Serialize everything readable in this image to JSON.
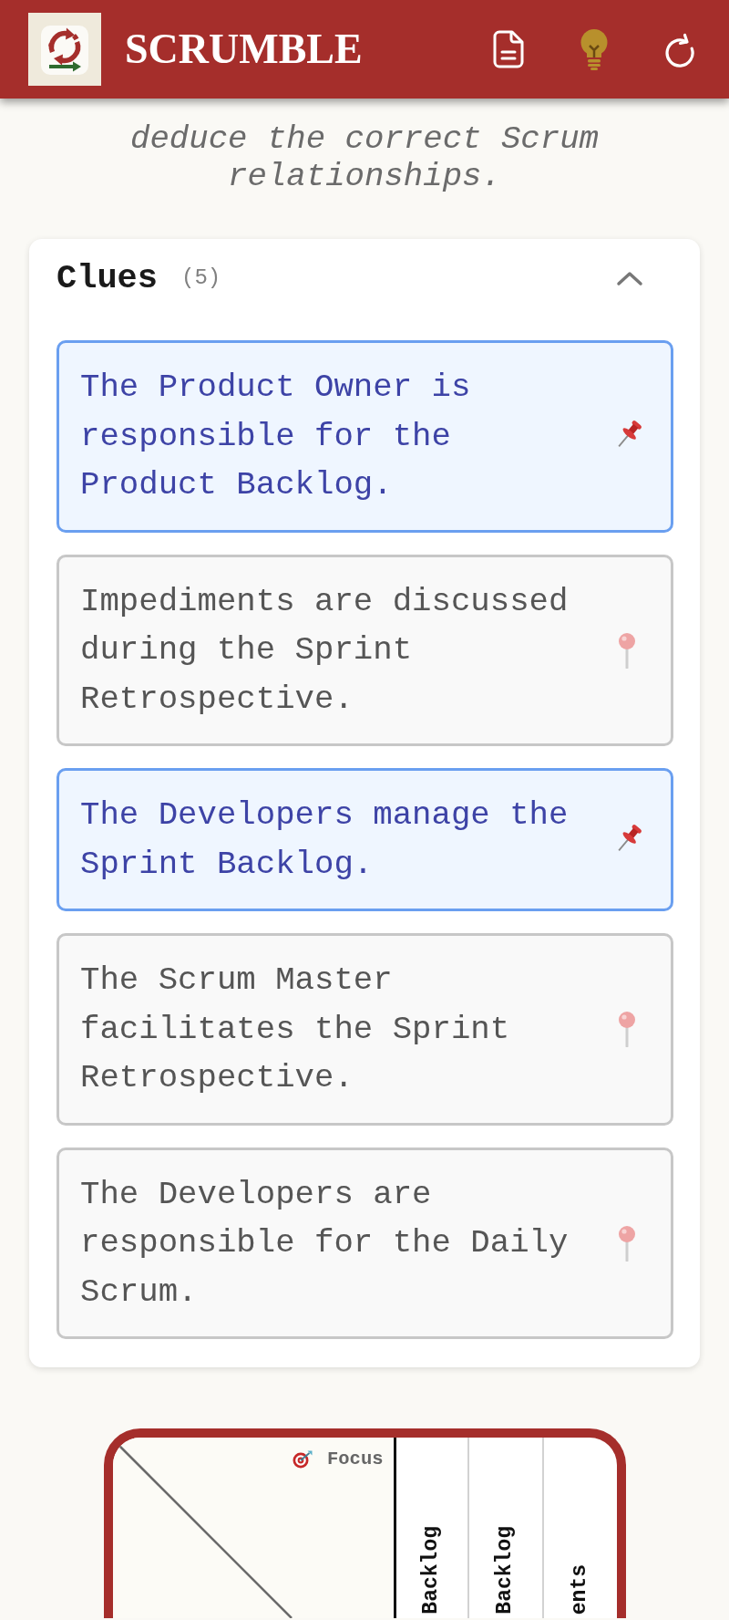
{
  "header": {
    "title": "SCRUMBLE"
  },
  "intro": {
    "text": "deduce the correct Scrum relationships."
  },
  "clues": {
    "title": "Clues",
    "count": "(5)",
    "expanded": true,
    "items": [
      {
        "text": "The Product Owner is responsible for the Product Backlog.",
        "pinned": true
      },
      {
        "text": "Impediments are discussed during the Sprint Retrospective.",
        "pinned": false
      },
      {
        "text": "The Developers manage the Sprint Backlog.",
        "pinned": true
      },
      {
        "text": "The Scrum Master facilitates the Sprint Retrospective.",
        "pinned": false
      },
      {
        "text": "The Developers are responsible for the Daily Scrum.",
        "pinned": false
      }
    ]
  },
  "grid": {
    "focus_label": "Focus",
    "column_headers": [
      "Backlog",
      "Backlog",
      "ents"
    ]
  }
}
